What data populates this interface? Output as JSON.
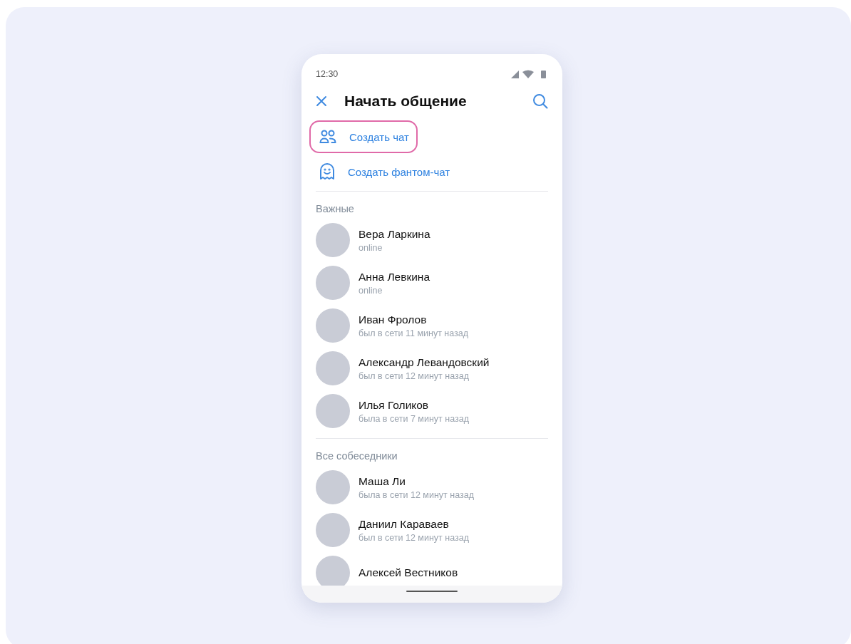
{
  "status_bar": {
    "time": "12:30"
  },
  "header": {
    "title": "Начать общение"
  },
  "actions": [
    {
      "kind": "group-chat",
      "label": "Создать чат",
      "highlighted": true
    },
    {
      "kind": "phantom-chat",
      "label": "Создать фантом-чат",
      "highlighted": false
    }
  ],
  "sections": [
    {
      "title": "Важные",
      "contacts": [
        {
          "name": "Вера Ларкина",
          "status": "online"
        },
        {
          "name": "Анна Левкина",
          "status": "online"
        },
        {
          "name": "Иван Фролов",
          "status": "был в сети 11 минут назад"
        },
        {
          "name": "Александр Левандовский",
          "status": "был в сети 12 минут назад"
        },
        {
          "name": "Илья Голиков",
          "status": "была в сети 7 минут назад"
        }
      ]
    },
    {
      "title": "Все собеседники",
      "contacts": [
        {
          "name": "Маша Ли",
          "status": "была в сети 12 минут назад"
        },
        {
          "name": "Даниил Караваев",
          "status": "был в сети 12 минут назад"
        },
        {
          "name": "Алексей Вестников"
        }
      ]
    }
  ]
}
